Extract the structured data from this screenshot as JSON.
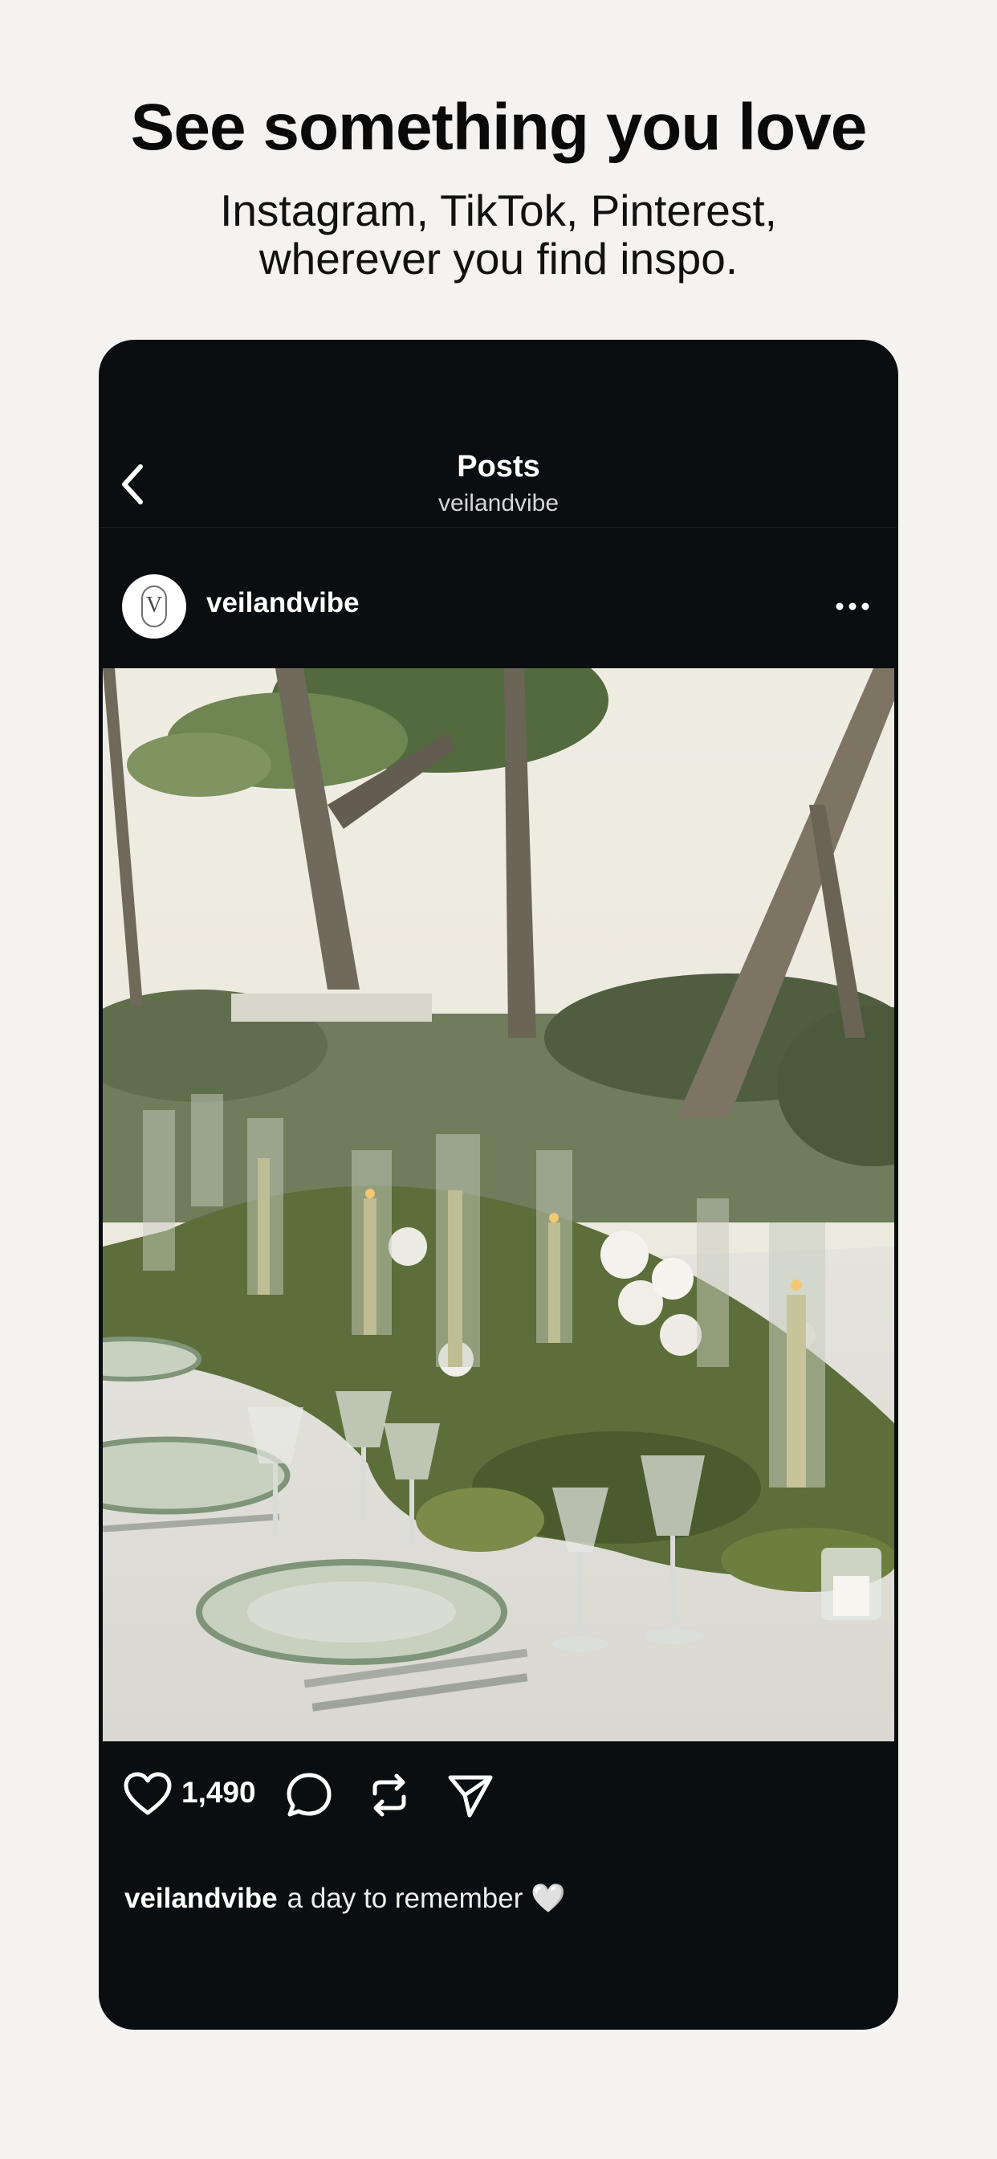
{
  "promo": {
    "headline": "See something you love",
    "subline": "Instagram, TikTok, Pinterest, wherever you find inspo."
  },
  "nav": {
    "back_icon": "chevron-left-icon",
    "title": "Posts",
    "subtitle": "veilandvibe"
  },
  "post": {
    "username": "veilandvibe",
    "avatar_letter": "V",
    "more_icon": "more-horizontal-icon",
    "likes": "1,490",
    "caption_user": "veilandvibe",
    "caption_text": "a day to remember 🤍",
    "action_icons": [
      "heart-icon",
      "comment-icon",
      "repost-icon",
      "share-icon"
    ]
  },
  "colors": {
    "page_background": "#f4f3f1",
    "phone_background": "#0b0e11",
    "text_primary": "#ffffff"
  }
}
